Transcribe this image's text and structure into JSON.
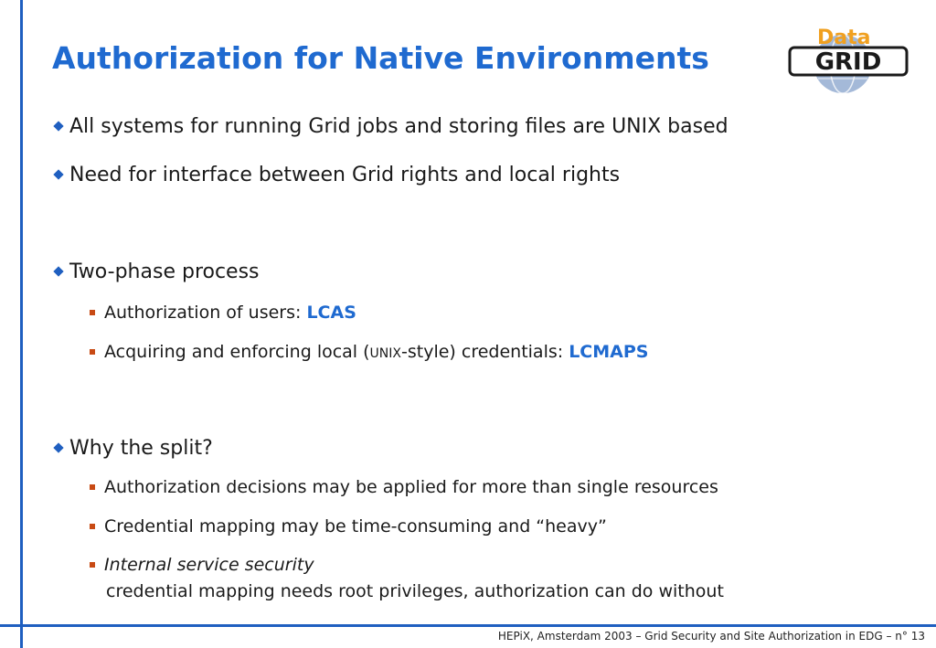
{
  "slide": {
    "title": "Authorization for Native Environments",
    "logo": {
      "word_top": "Data",
      "word_main": "GRID",
      "colors": {
        "orange": "#f0a020",
        "dark": "#1a1a1a",
        "globe": "#5a7fb8"
      }
    },
    "bullets": [
      {
        "text": "All systems for running Grid jobs and storing files are UNIX based"
      },
      {
        "text": "Need for interface between Grid rights and local rights"
      },
      {
        "text": "Two-phase process"
      },
      {
        "text": "Why the split?"
      }
    ],
    "two_phase": {
      "item1": {
        "prefix": "Authorization of users: ",
        "highlight": "LCAS"
      },
      "item2": {
        "prefix": "Acquiring and enforcing local (",
        "small": "UNIX",
        "mid": "-style) credentials: ",
        "highlight": "LCMAPS"
      }
    },
    "split": {
      "item1": "Authorization decisions may be applied for more than single resources",
      "item2": "Credential mapping may be time-consuming and “heavy”",
      "item3_italic": "Internal service security",
      "item3_cont": "credential mapping needs root privileges, authorization can do without"
    },
    "footer": "HEPiX, Amsterdam 2003 – Grid Security and Site Authorization in EDG –  n° 13",
    "colors": {
      "accent_blue": "#1f6ad0",
      "rule_blue": "#1f5fc0",
      "sub_bullet": "#c84a14"
    }
  }
}
